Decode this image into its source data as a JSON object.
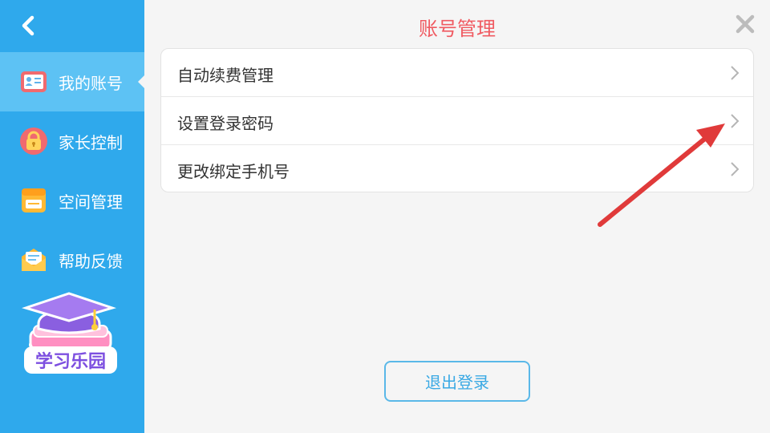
{
  "page": {
    "title": "账号管理"
  },
  "sidebar": {
    "items": [
      {
        "label": "我的账号",
        "icon": "id-card-icon",
        "active": true
      },
      {
        "label": "家长控制",
        "icon": "lock-icon",
        "active": false
      },
      {
        "label": "空间管理",
        "icon": "folder-icon",
        "active": false
      },
      {
        "label": "帮助反馈",
        "icon": "envelope-icon",
        "active": false
      }
    ],
    "mascot_text": "学习乐园"
  },
  "menu": {
    "items": [
      {
        "label": "自动续费管理"
      },
      {
        "label": "设置登录密码"
      },
      {
        "label": "更改绑定手机号"
      }
    ]
  },
  "logout_label": "退出登录",
  "colors": {
    "sidebar": "#2fa9ec",
    "sidebar_active": "#5dc2f4",
    "title": "#f05a61",
    "accent": "#3aa9e4",
    "annotation_arrow": "#e03a3a"
  }
}
